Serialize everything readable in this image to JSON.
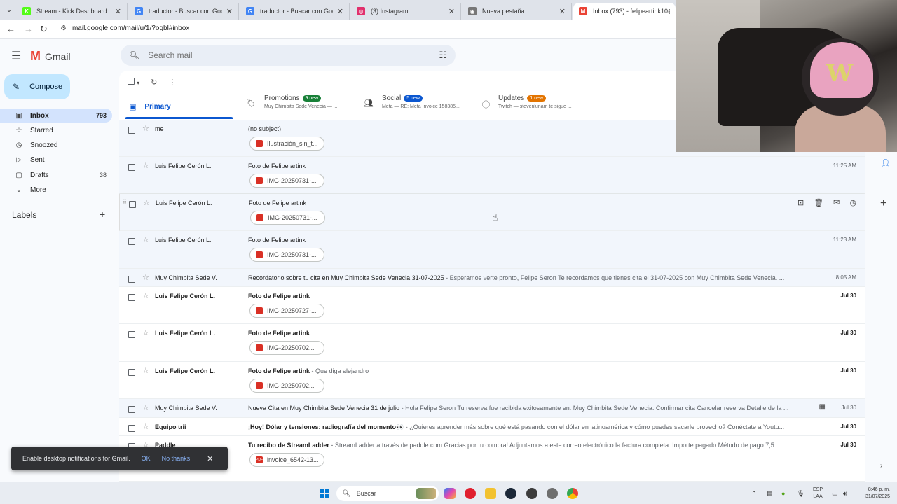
{
  "browser": {
    "tabs": [
      {
        "title": "Stream - Kick Dashboard",
        "favicon": "kick-icon",
        "color": "#53fc18"
      },
      {
        "title": "traductor - Buscar con Google",
        "favicon": "google-icon",
        "color": "#4285f4"
      },
      {
        "title": "traductor - Buscar con Google",
        "favicon": "google-icon",
        "color": "#4285f4"
      },
      {
        "title": "(3) Instagram",
        "favicon": "instagram-icon",
        "color": "#e1306c"
      },
      {
        "title": "Nueva pestaña",
        "favicon": "chrome-icon",
        "color": "#777777"
      },
      {
        "title": "Inbox (793) - felipeartink10@g",
        "favicon": "gmail-icon",
        "color": "#ea4335"
      }
    ],
    "url": "mail.google.com/mail/u/1/?ogbl#inbox"
  },
  "gmail": {
    "logo_text": "Gmail",
    "search_placeholder": "Search mail",
    "compose_label": "Compose",
    "sidebar": [
      {
        "label": "Inbox",
        "count": "793",
        "icon": "inbox-icon",
        "active": true
      },
      {
        "label": "Starred",
        "count": "",
        "icon": "star-icon"
      },
      {
        "label": "Snoozed",
        "count": "",
        "icon": "clock-icon"
      },
      {
        "label": "Sent",
        "count": "",
        "icon": "send-icon"
      },
      {
        "label": "Drafts",
        "count": "38",
        "icon": "draft-icon"
      },
      {
        "label": "More",
        "count": "",
        "icon": "chevron-down-icon"
      }
    ],
    "labels_title": "Labels",
    "categories": {
      "primary": {
        "label": "Primary"
      },
      "promotions": {
        "label": "Promotions",
        "badge": "9 new",
        "badge_color": "#188038",
        "sub": "Muy Chimbita Sede Venecia — ..."
      },
      "social": {
        "label": "Social",
        "badge": "5 new",
        "badge_color": "#0b57d0",
        "sub": "Meta — RE: Meta Invoice 158385..."
      },
      "updates": {
        "label": "Updates",
        "badge": "1 new",
        "badge_color": "#e37400",
        "sub": "Twitch — stevenlunam te sigue ..."
      }
    },
    "emails": [
      {
        "sender": "me",
        "subject": "(no subject)",
        "snippet": "",
        "date": "",
        "attachment": "Ilustración_sin_t...",
        "unread": false
      },
      {
        "sender": "Luis Felipe Cerón L.",
        "subject": "Foto de Felipe artink",
        "snippet": "",
        "date": "11:25 AM",
        "attachment": "IMG-20250731-...",
        "unread": false
      },
      {
        "sender": "Luis Felipe Cerón L.",
        "subject": "Foto de Felipe artink",
        "snippet": "",
        "date": "",
        "attachment": "IMG-20250731-...",
        "unread": false
      },
      {
        "sender": "Luis Felipe Cerón L.",
        "subject": "Foto de Felipe artink",
        "snippet": "",
        "date": "11:23 AM",
        "attachment": "IMG-20250731-...",
        "unread": false
      },
      {
        "sender": "Muy Chimbita Sede V.",
        "subject": "Recordatorio sobre tu cita en Muy Chimbita Sede Venecia 31-07-2025",
        "snippet": " - Esperamos verte pronto, Felipe Seron Te recordamos que tienes cita el 31-07-2025 con Muy Chimbita Sede Venecia. ...",
        "date": "8:05 AM",
        "attachment": "",
        "unread": false
      },
      {
        "sender": "Luis Felipe Cerón L.",
        "subject": "Foto de Felipe artink",
        "snippet": "",
        "date": "Jul 30",
        "attachment": "IMG-20250727-...",
        "unread": true
      },
      {
        "sender": "Luis Felipe Cerón L.",
        "subject": "Foto de Felipe artink",
        "snippet": "",
        "date": "Jul 30",
        "attachment": "IMG-20250702...",
        "unread": true
      },
      {
        "sender": "Luis Felipe Cerón L.",
        "subject": "Foto de Felipe artink",
        "snippet": " - Que diga alejandro",
        "date": "Jul 30",
        "attachment": "IMG-20250702...",
        "unread": true
      },
      {
        "sender": "Muy Chimbita Sede V.",
        "subject": "Nueva Cita en Muy Chimbita Sede Venecia 31 de julio",
        "snippet": " - Hola Felipe Seron Tu reserva fue recibida exitosamente en: Muy Chimbita Sede Venecia. Confirmar cita Cancelar reserva Detalle de la ...",
        "date": "Jul 30",
        "attachment": "",
        "unread": false
      },
      {
        "sender": "Equipo trii",
        "subject": "¡Hoy! Dólar y tensiones: radiografía del momento👀",
        "snippet": " - ¿Quieres aprender más sobre qué está pasando con el dólar en latinoamérica y cómo puedes sacarle provecho? Conéctate a Youtu...",
        "date": "Jul 30",
        "attachment": "",
        "unread": true
      },
      {
        "sender": "Paddle",
        "subject": "Tu recibo de StreamLadder",
        "snippet": " - StreamLadder a través de paddle.com Gracias por tu compra! Adjuntamos a este correo electrónico la factura completa. Importe pagado Método de pago 7,5...",
        "date": "Jul 30",
        "attachment": "invoice_6542-13...",
        "unread": true
      }
    ]
  },
  "toast": {
    "message": "Enable desktop notifications for Gmail.",
    "ok": "OK",
    "no_thanks": "No thanks"
  },
  "taskbar": {
    "search_placeholder": "Buscar",
    "lang_top": "ESP",
    "lang_bottom": "LAA",
    "time": "8:46 p. m.",
    "date": "31/07/2025"
  }
}
